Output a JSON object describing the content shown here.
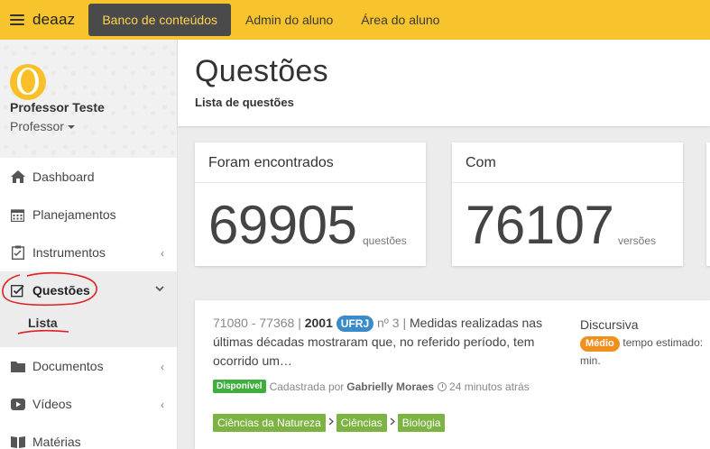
{
  "topbar": {
    "brand": "deaaz",
    "tabs": [
      {
        "label": "Banco de conteúdos",
        "active": true
      },
      {
        "label": "Admin do aluno",
        "active": false
      },
      {
        "label": "Área do aluno",
        "active": false
      }
    ],
    "accent_color": "#f8c42d"
  },
  "profile": {
    "name": "Professor Teste",
    "role": "Professor"
  },
  "sidebar": {
    "items": [
      {
        "label": "Dashboard",
        "icon": "home-icon"
      },
      {
        "label": "Planejamentos",
        "icon": "calendar-icon"
      },
      {
        "label": "Instrumentos",
        "icon": "clipboard-icon",
        "chevron": "‹"
      },
      {
        "label": "Questões",
        "icon": "check-square-icon",
        "chevron": "⌄",
        "open": true
      },
      {
        "label": "Documentos",
        "icon": "folder-icon",
        "chevron": "‹"
      },
      {
        "label": "Vídeos",
        "icon": "play-icon",
        "chevron": "‹"
      },
      {
        "label": "Matérias",
        "icon": "book-icon"
      }
    ],
    "submenu": {
      "label": "Lista"
    }
  },
  "header": {
    "title": "Questões",
    "subtitle": "Lista de questões"
  },
  "stats": [
    {
      "heading": "Foram encontrados",
      "value": "69905",
      "unit": "questões"
    },
    {
      "heading": "Com",
      "value": "76107",
      "unit": "versões"
    }
  ],
  "question": {
    "ids": "71080 - 77368 |",
    "year": "2001",
    "institution": "UFRJ",
    "number": "nº 3 |",
    "text": "Medidas realizadas nas últimas décadas mostraram que, no referido período, tem ocorrido um…",
    "status": "Disponível",
    "registered_by": "Cadastrada por",
    "author": "Gabrielly Moraes",
    "time_ago": "24 minutos atrás",
    "type": "Discursiva",
    "difficulty": "Médio",
    "estimated_time_label": "tempo estimado:",
    "estimated_time_unit": "min.",
    "tags": [
      "Ciências da Natureza",
      "Ciências",
      "Biologia"
    ]
  }
}
